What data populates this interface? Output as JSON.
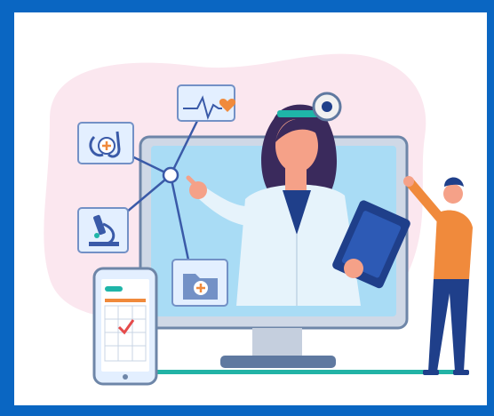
{
  "illustration": {
    "icons": [
      "stethoscope-icon",
      "heart-rate-icon",
      "microscope-icon",
      "medical-folder-icon",
      "calendar-check-icon"
    ],
    "colors": {
      "frame": "#0a66c2",
      "background": "#ffffff",
      "blob": "#fbe7ef",
      "screen": "#a9dcf5",
      "screen_border": "#6e86a8",
      "monitor_body": "#cfd8e6",
      "coat": "#e6f3fb",
      "hair": "#3a2a5c",
      "skin": "#f5a188",
      "accent_orange": "#f08a3c",
      "navy": "#1f3f8a",
      "icon_tile": "#e3efff",
      "teal": "#1fb5a8"
    }
  }
}
